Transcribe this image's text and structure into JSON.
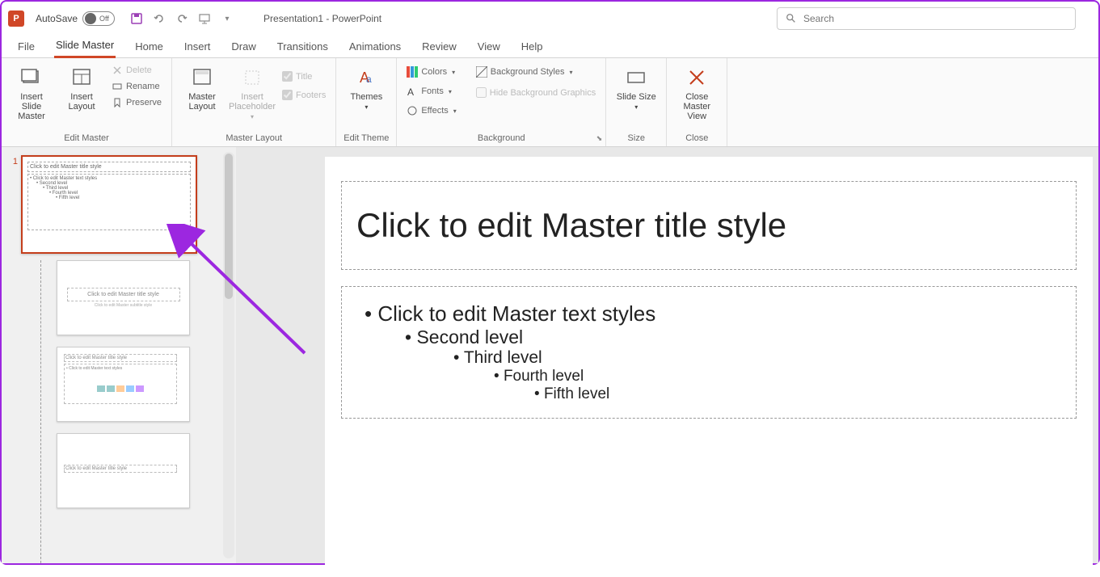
{
  "titlebar": {
    "autosave_label": "AutoSave",
    "autosave_state": "Off",
    "doc_title": "Presentation1  -  PowerPoint",
    "search_placeholder": "Search"
  },
  "tabs": [
    "File",
    "Slide Master",
    "Home",
    "Insert",
    "Draw",
    "Transitions",
    "Animations",
    "Review",
    "View",
    "Help"
  ],
  "active_tab": "Slide Master",
  "ribbon": {
    "edit_master": {
      "label": "Edit Master",
      "insert_slide_master": "Insert Slide Master",
      "insert_layout": "Insert Layout",
      "delete": "Delete",
      "rename": "Rename",
      "preserve": "Preserve"
    },
    "master_layout": {
      "label": "Master Layout",
      "master_layout_btn": "Master Layout",
      "insert_placeholder": "Insert Placeholder",
      "title_chk": "Title",
      "footers_chk": "Footers"
    },
    "edit_theme": {
      "label": "Edit Theme",
      "themes": "Themes"
    },
    "background": {
      "label": "Background",
      "colors": "Colors",
      "fonts": "Fonts",
      "effects": "Effects",
      "bg_styles": "Background Styles",
      "hide_bg": "Hide Background Graphics"
    },
    "size": {
      "label": "Size",
      "slide_size": "Slide Size"
    },
    "close": {
      "label": "Close",
      "close_master": "Close Master View"
    }
  },
  "thumbnails": {
    "master_num": "1",
    "master_title": "Click to edit Master title style",
    "master_body": "• Click to edit Master text styles",
    "layout_title": "Click to edit Master title style"
  },
  "slide": {
    "title": "Click to edit Master title style",
    "lvl1": "Click to edit Master text styles",
    "lvl2": "Second level",
    "lvl3": "Third level",
    "lvl4": "Fourth level",
    "lvl5": "Fifth level"
  }
}
